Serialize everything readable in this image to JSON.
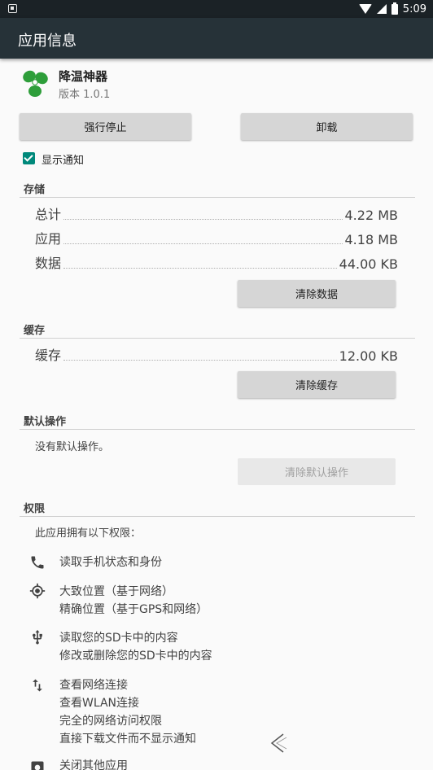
{
  "status_bar": {
    "time": "5:09",
    "notification_icon": "app-notification-icon"
  },
  "toolbar": {
    "title": "应用信息"
  },
  "app": {
    "name": "降温神器",
    "version": "版本 1.0.1",
    "icon": "fan-icon",
    "icon_color": "#2e9e3a"
  },
  "actions": {
    "force_stop": "强行停止",
    "uninstall": "卸载"
  },
  "notification": {
    "label": "显示通知",
    "checked": true,
    "accent": "#00897b"
  },
  "storage": {
    "title": "存储",
    "rows": [
      {
        "label": "总计",
        "value": "4.22 MB"
      },
      {
        "label": "应用",
        "value": "4.18 MB"
      },
      {
        "label": "数据",
        "value": "44.00 KB"
      }
    ],
    "clear_button": "清除数据"
  },
  "cache": {
    "title": "缓存",
    "rows": [
      {
        "label": "缓存",
        "value": "12.00 KB"
      }
    ],
    "clear_button": "清除缓存"
  },
  "defaults": {
    "title": "默认操作",
    "text": "没有默认操作。",
    "clear_button": "清除默认操作"
  },
  "permissions": {
    "title": "权限",
    "intro": "此应用拥有以下权限：",
    "groups": [
      {
        "icon": "phone-icon",
        "items": [
          "读取手机状态和身份"
        ]
      },
      {
        "icon": "location-icon",
        "items": [
          "大致位置（基于网络）",
          "精确位置（基于GPS和网络）"
        ]
      },
      {
        "icon": "usb-icon",
        "items": [
          "读取您的SD卡中的内容",
          "修改或删除您的SD卡中的内容"
        ]
      },
      {
        "icon": "network-arrows-icon",
        "items": [
          "查看网络连接",
          "查看WLAN连接",
          "完全的网络访问权限",
          "直接下载文件而不显示通知"
        ]
      },
      {
        "icon": "app-icon",
        "items": [
          "关闭其他应用"
        ]
      }
    ]
  }
}
